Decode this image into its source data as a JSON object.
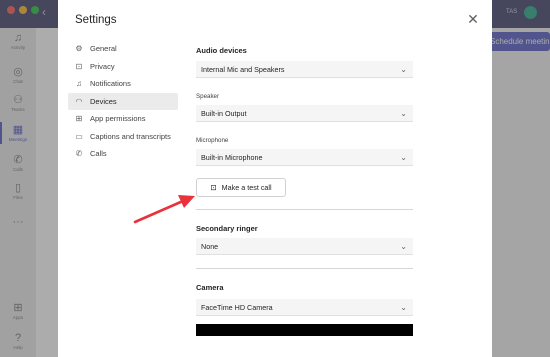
{
  "background": {
    "rail_items": [
      {
        "label": "Activity",
        "icon": "bell-icon"
      },
      {
        "label": "Chat",
        "icon": "chat-icon"
      },
      {
        "label": "Teams",
        "icon": "teams-icon"
      },
      {
        "label": "Meetings",
        "icon": "calendar-icon"
      },
      {
        "label": "Calls",
        "icon": "phone-icon"
      },
      {
        "label": "Files",
        "icon": "file-icon"
      },
      {
        "label": "Apps",
        "icon": "apps-icon"
      },
      {
        "label": "Help",
        "icon": "help-icon"
      }
    ],
    "user_initials": "TAS",
    "schedule_button": "Schedule meeting"
  },
  "modal": {
    "title": "Settings",
    "nav": [
      {
        "label": "General",
        "icon": "gear-icon"
      },
      {
        "label": "Privacy",
        "icon": "lock-icon"
      },
      {
        "label": "Notifications",
        "icon": "bell-icon"
      },
      {
        "label": "Devices",
        "icon": "headset-icon",
        "active": true
      },
      {
        "label": "App permissions",
        "icon": "grid-icon"
      },
      {
        "label": "Captions and transcripts",
        "icon": "captions-icon"
      },
      {
        "label": "Calls",
        "icon": "phone-icon"
      }
    ],
    "audio": {
      "title": "Audio devices",
      "device": "Internal Mic and Speakers",
      "speaker_label": "Speaker",
      "speaker": "Built-in Output",
      "mic_label": "Microphone",
      "mic": "Built-in Microphone",
      "test_call": "Make a test call"
    },
    "secondary": {
      "title": "Secondary ringer",
      "value": "None"
    },
    "camera": {
      "title": "Camera",
      "value": "FaceTime HD Camera"
    }
  },
  "colors": {
    "accent": "#5b5fc7",
    "titlebar": "#45466f",
    "arrow": "#e8323c"
  }
}
